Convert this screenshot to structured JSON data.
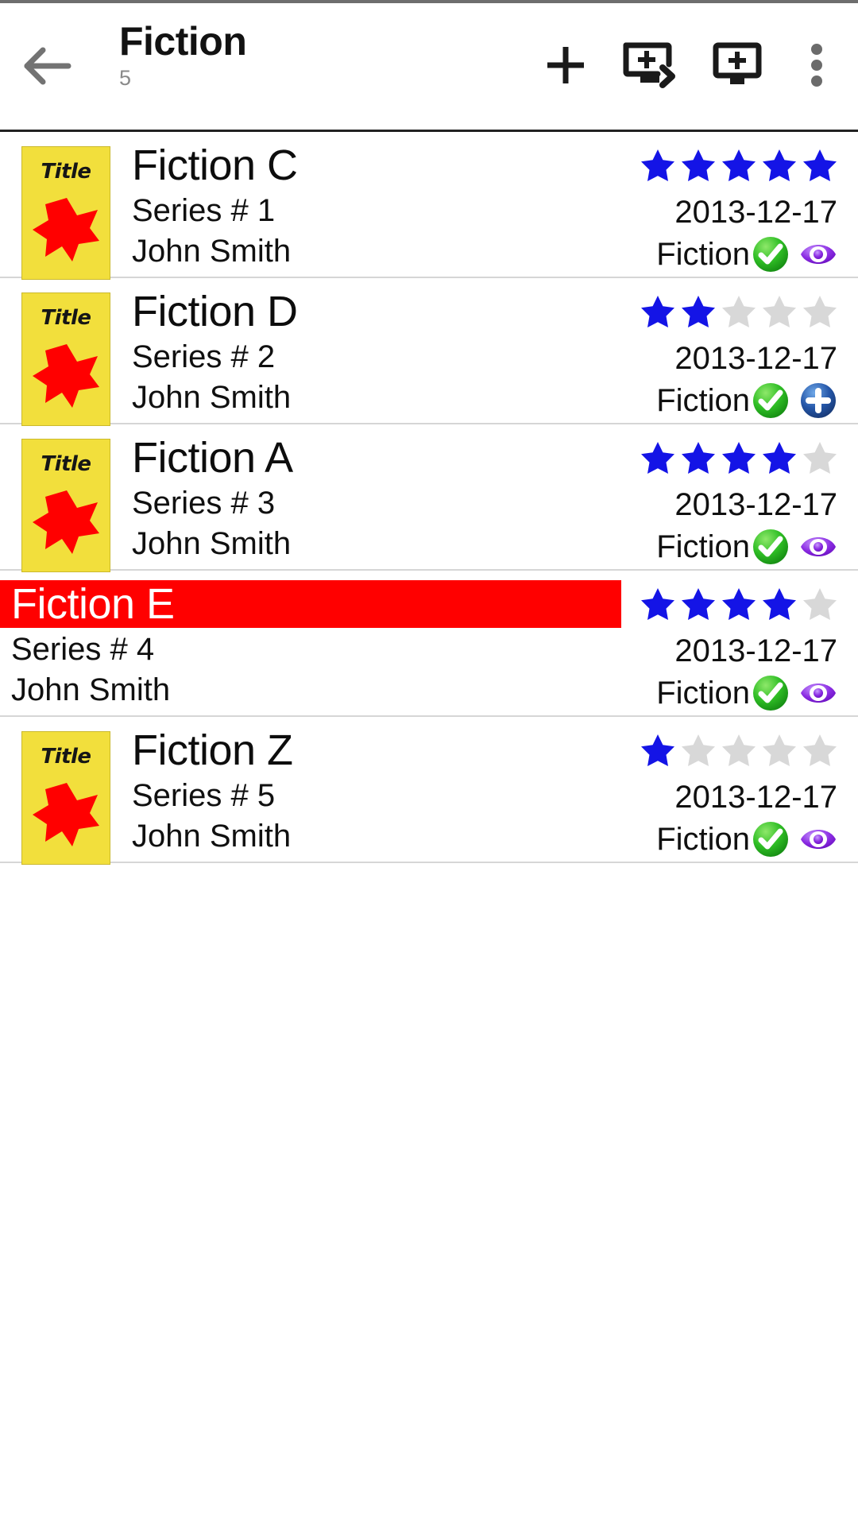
{
  "header": {
    "back_icon": "arrow-left-icon",
    "title": "Fiction",
    "count": "5",
    "actions": [
      {
        "name": "add-button",
        "icon": "plus-icon"
      },
      {
        "name": "add-to-screen-send-button",
        "icon": "monitor-plus-arrow-icon"
      },
      {
        "name": "add-to-screen-button",
        "icon": "monitor-plus-icon"
      },
      {
        "name": "overflow-menu-button",
        "icon": "more-vertical-icon"
      }
    ]
  },
  "colors": {
    "star_filled": "#1414E6",
    "star_empty": "#D8D8D8",
    "highlight": "#FF0000",
    "thumb_bg": "#F2DF3C",
    "thumb_star": "#FF0000",
    "check_badge": "#1FA91F",
    "eye_badge": "#8A2BE2",
    "plus_badge": "#2255AA",
    "divider": "#D6D6D6"
  },
  "thumbnail": {
    "label": "Title"
  },
  "list": {
    "max_stars": 5,
    "rows": [
      {
        "title": "Fiction C",
        "series": "Series # 1",
        "author": "John Smith",
        "rating": 5,
        "date": "2013-12-17",
        "category": "Fiction",
        "has_thumbnail": true,
        "highlighted": false,
        "badge_check": "check-badge-icon",
        "badge_second": "eye-badge-icon"
      },
      {
        "title": "Fiction D",
        "series": "Series # 2",
        "author": "John Smith",
        "rating": 2,
        "date": "2013-12-17",
        "category": "Fiction",
        "has_thumbnail": true,
        "highlighted": false,
        "badge_check": "check-badge-icon",
        "badge_second": "plus-badge-icon"
      },
      {
        "title": "Fiction A",
        "series": "Series # 3",
        "author": "John Smith",
        "rating": 4,
        "date": "2013-12-17",
        "category": "Fiction",
        "has_thumbnail": true,
        "highlighted": false,
        "badge_check": "check-badge-icon",
        "badge_second": "eye-badge-icon"
      },
      {
        "title": "Fiction E",
        "series": "Series # 4",
        "author": "John Smith",
        "rating": 4,
        "date": "2013-12-17",
        "category": "Fiction",
        "has_thumbnail": false,
        "highlighted": true,
        "badge_check": "check-badge-icon",
        "badge_second": "eye-badge-icon"
      },
      {
        "title": "Fiction Z",
        "series": "Series # 5",
        "author": "John Smith",
        "rating": 1,
        "date": "2013-12-17",
        "category": "Fiction",
        "has_thumbnail": true,
        "highlighted": false,
        "badge_check": "check-badge-icon",
        "badge_second": "eye-badge-icon"
      }
    ]
  }
}
